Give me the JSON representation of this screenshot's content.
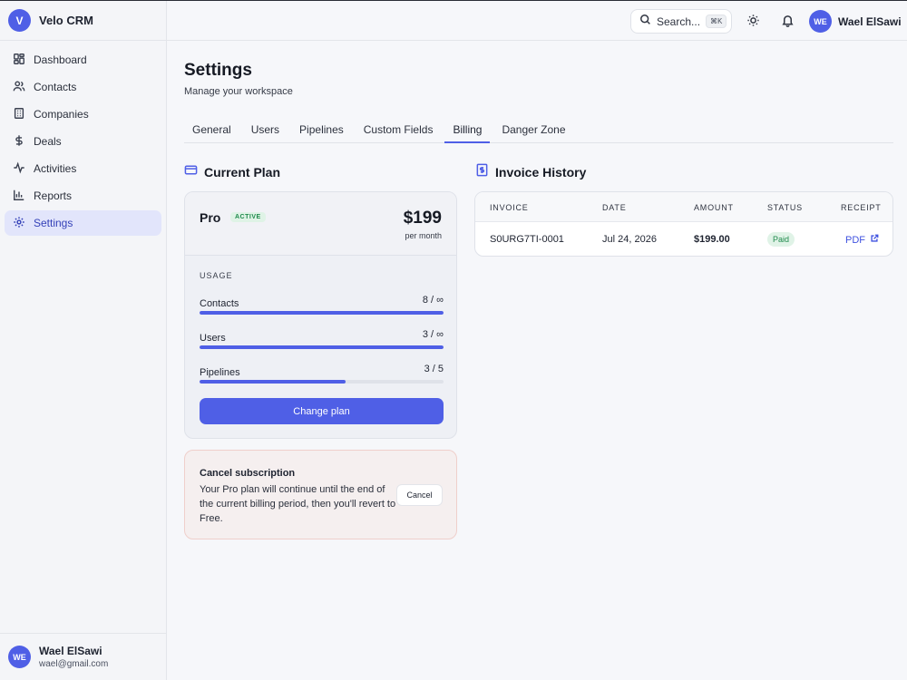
{
  "app": {
    "logo_letter": "V",
    "name": "Velo CRM"
  },
  "sidebar": {
    "items": [
      {
        "label": "Dashboard",
        "icon": "dashboard-icon"
      },
      {
        "label": "Contacts",
        "icon": "users-icon"
      },
      {
        "label": "Companies",
        "icon": "building-icon"
      },
      {
        "label": "Deals",
        "icon": "dollar-icon"
      },
      {
        "label": "Activities",
        "icon": "activity-icon"
      },
      {
        "label": "Reports",
        "icon": "bar-chart-icon"
      },
      {
        "label": "Settings",
        "icon": "gear-icon"
      }
    ],
    "active": "Settings",
    "user": {
      "initials": "WE",
      "name": "Wael ElSawi",
      "email": "wael@gmail.com"
    }
  },
  "topbar": {
    "search_label": "Search...",
    "search_shortcut": "⌘K",
    "user": {
      "initials": "WE",
      "name": "Wael ElSawi"
    }
  },
  "page": {
    "title": "Settings",
    "subtitle": "Manage your workspace",
    "tabs": [
      "General",
      "Users",
      "Pipelines",
      "Custom Fields",
      "Billing",
      "Danger Zone"
    ],
    "active_tab": "Billing"
  },
  "current_plan": {
    "section_title": "Current Plan",
    "plan_name": "Pro",
    "badge": "ACTIVE",
    "price": "$199",
    "period": "per month",
    "usage_title": "USAGE",
    "usage": [
      {
        "label": "Contacts",
        "value": "8 / ∞",
        "fill": 1.0
      },
      {
        "label": "Users",
        "value": "3 / ∞",
        "fill": 1.0
      },
      {
        "label": "Pipelines",
        "value": "3 / 5",
        "fill": 0.6
      }
    ],
    "change_button": "Change plan"
  },
  "cancel": {
    "title": "Cancel subscription",
    "text": "Your Pro plan will continue until the end of the current billing period, then you'll revert to Free.",
    "button": "Cancel"
  },
  "invoices": {
    "section_title": "Invoice History",
    "columns": [
      "INVOICE",
      "DATE",
      "AMOUNT",
      "STATUS",
      "RECEIPT"
    ],
    "rows": [
      {
        "invoice": "S0URG7TI-0001",
        "date": "Jul 24, 2026",
        "amount": "$199.00",
        "status": "Paid",
        "receipt": "PDF"
      }
    ]
  },
  "colors": {
    "accent": "#4f5fe6",
    "success": "#1f8a4c",
    "danger_border": "#efcfcb"
  }
}
